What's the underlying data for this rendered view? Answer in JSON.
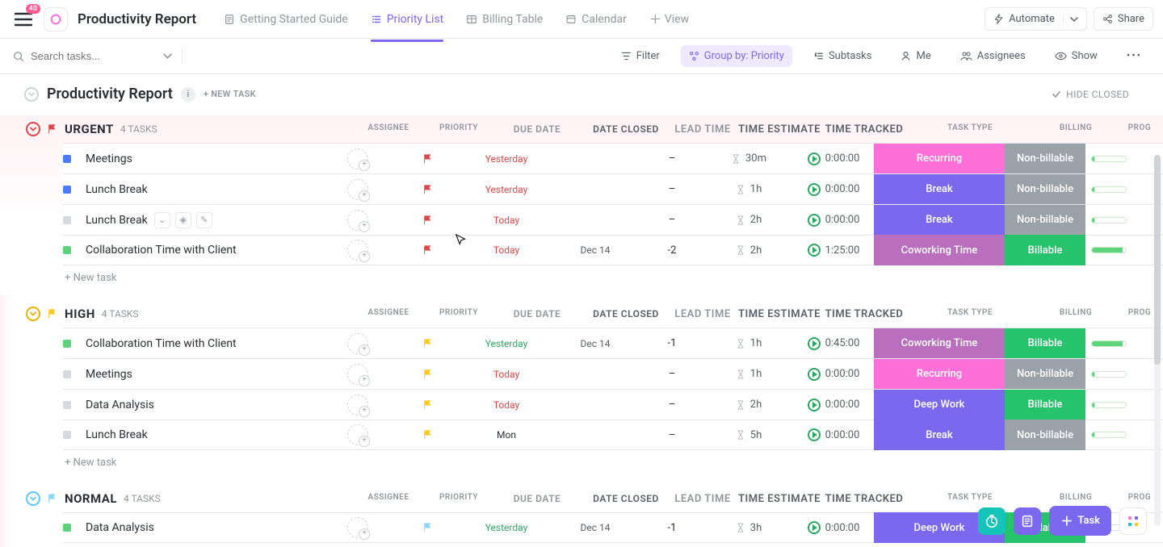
{
  "topbar": {
    "badge": "40",
    "title": "Productivity Report",
    "tabs": [
      {
        "label": "Getting Started Guide"
      },
      {
        "label": "Priority List",
        "active": true
      },
      {
        "label": "Billing Table"
      },
      {
        "label": "Calendar"
      }
    ],
    "add_view": "View",
    "automate": "Automate",
    "share": "Share"
  },
  "toolbar": {
    "search_placeholder": "Search tasks...",
    "filter": "Filter",
    "group_by": "Group by: Priority",
    "subtasks": "Subtasks",
    "me": "Me",
    "assignees": "Assignees",
    "show": "Show"
  },
  "report": {
    "title": "Productivity Report",
    "new_task": "+ NEW TASK",
    "hide_closed": "HIDE CLOSED"
  },
  "columns": [
    "ASSIGNEE",
    "PRIORITY",
    "DUE DATE",
    "DATE CLOSED",
    "LEAD TIME",
    "TIME ESTIMATE",
    "TIME TRACKED",
    "TASK TYPE",
    "BILLING",
    "PROG"
  ],
  "groups": [
    {
      "key": "urgent",
      "name": "URGENT",
      "count": "4 TASKS",
      "flag": "red",
      "chev": "red",
      "tasks": [
        {
          "status": "blue",
          "name": "Meetings",
          "due": "Yesterday",
          "due_cls": "red",
          "closed": "",
          "lead": "–",
          "est": "30m",
          "track": "0:00:00",
          "type": "Recurring",
          "type_bg": "pink",
          "bill": "Non-billable",
          "bill_bg": "grey",
          "prog": 6
        },
        {
          "status": "blue",
          "name": "Lunch Break",
          "due": "Yesterday",
          "due_cls": "red",
          "closed": "",
          "lead": "–",
          "est": "1h",
          "track": "0:00:00",
          "type": "Break",
          "type_bg": "purple",
          "bill": "Non-billable",
          "bill_bg": "grey",
          "prog": 6
        },
        {
          "status": "grey",
          "name": "Lunch Break",
          "hover": true,
          "due": "Today",
          "due_cls": "red",
          "closed": "",
          "lead": "–",
          "est": "2h",
          "track": "0:00:00",
          "type": "Break",
          "type_bg": "purple",
          "bill": "Non-billable",
          "bill_bg": "grey",
          "prog": 6
        },
        {
          "status": "green",
          "name": "Collaboration Time with Client",
          "due": "Today",
          "due_cls": "red",
          "closed": "Dec 14",
          "lead": "-2",
          "est": "2h",
          "track": "1:25:00",
          "type": "Coworking Time",
          "type_bg": "dp",
          "bill": "Billable",
          "bill_bg": "green",
          "prog": 90
        }
      ],
      "add": "+ New task"
    },
    {
      "key": "high",
      "name": "HIGH",
      "count": "4 TASKS",
      "flag": "yellow",
      "chev": "yellow",
      "tasks": [
        {
          "status": "green",
          "name": "Collaboration Time with Client",
          "due": "Yesterday",
          "due_cls": "green",
          "closed": "Dec 14",
          "lead": "-1",
          "est": "1h",
          "track": "0:45:00",
          "type": "Coworking Time",
          "type_bg": "dp",
          "bill": "Billable",
          "bill_bg": "green",
          "prog": 90
        },
        {
          "status": "grey",
          "name": "Meetings",
          "due": "Today",
          "due_cls": "red",
          "closed": "",
          "lead": "–",
          "est": "1h",
          "track": "0:00:00",
          "type": "Recurring",
          "type_bg": "pink",
          "bill": "Non-billable",
          "bill_bg": "grey",
          "prog": 6
        },
        {
          "status": "grey",
          "name": "Data Analysis",
          "due": "Today",
          "due_cls": "red",
          "closed": "",
          "lead": "–",
          "est": "2h",
          "track": "0:00:00",
          "type": "Deep Work",
          "type_bg": "purple",
          "bill": "Billable",
          "bill_bg": "green",
          "prog": 6
        },
        {
          "status": "grey",
          "name": "Lunch Break",
          "due": "Mon",
          "due_cls": "",
          "closed": "",
          "lead": "–",
          "est": "5h",
          "track": "0:00:00",
          "type": "Break",
          "type_bg": "purple",
          "bill": "Non-billable",
          "bill_bg": "grey",
          "prog": 6
        }
      ],
      "add": "+ New task"
    },
    {
      "key": "normal",
      "name": "NORMAL",
      "count": "4 TASKS",
      "flag": "blue",
      "chev": "blue",
      "tasks": [
        {
          "status": "green",
          "name": "Data Analysis",
          "due": "Yesterday",
          "due_cls": "green",
          "closed": "Dec 14",
          "lead": "-1",
          "est": "3h",
          "track": "0:00:00",
          "type": "Deep Work",
          "type_bg": "purple",
          "bill": "Billable",
          "bill_bg": "green",
          "prog": 6
        }
      ]
    }
  ],
  "float": {
    "task": "Task"
  }
}
